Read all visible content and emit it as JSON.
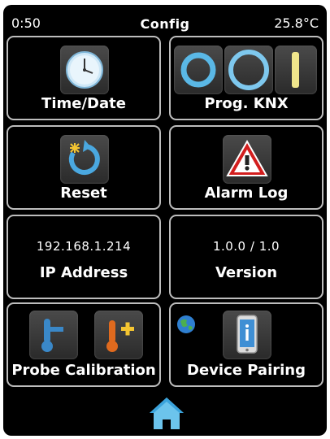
{
  "status": {
    "time": "0:50",
    "title": "Config",
    "temperature": "25.8°C"
  },
  "tiles": {
    "time_date": {
      "label": "Time/Date",
      "icon": "clock-icon"
    },
    "prog_knx": {
      "label": "Prog. KNX",
      "icons": [
        "ring-small-icon",
        "ring-large-icon",
        "bar-indicator-icon"
      ]
    },
    "reset": {
      "label": "Reset",
      "icon": "reset-icon"
    },
    "alarm_log": {
      "label": "Alarm Log",
      "icon": "warning-triangle-icon"
    },
    "ip_address": {
      "label": "IP Address",
      "value": "192.168.1.214"
    },
    "version": {
      "label": "Version",
      "value": "1.0.0 / 1.0"
    },
    "probe_calibration": {
      "label": "Probe Calibration",
      "icons": [
        "thermometer-icon",
        "thermometer-plus-icon"
      ]
    },
    "device_pairing": {
      "label": "Device Pairing",
      "icons": [
        "globe-icon",
        "phone-info-icon"
      ]
    }
  },
  "footer": {
    "icon": "home-icon"
  },
  "colors": {
    "background": "#000000",
    "tile_border": "#bdbdbd",
    "accent_blue": "#5ab8e6",
    "alarm_red": "#d21e1e",
    "knx_yellow": "#f0e68c"
  }
}
